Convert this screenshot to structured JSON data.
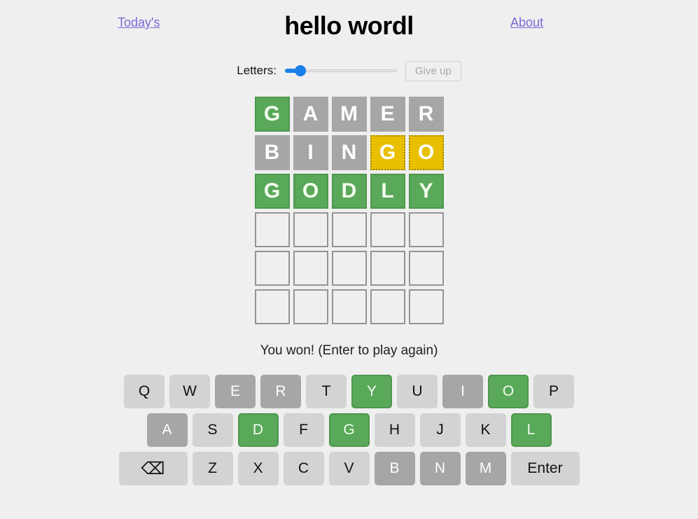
{
  "header": {
    "title": "hello wordl",
    "left_link": "Today's",
    "right_link": "About"
  },
  "controls": {
    "letters_label": "Letters:",
    "slider_value": 5,
    "slider_min": 4,
    "slider_max": 11,
    "give_up_label": "Give up",
    "give_up_disabled": true
  },
  "board": {
    "rows": 6,
    "columns": 5,
    "guesses": [
      {
        "word": "GAMER",
        "tiles": [
          {
            "letter": "G",
            "state": "correct"
          },
          {
            "letter": "A",
            "state": "absent"
          },
          {
            "letter": "M",
            "state": "absent"
          },
          {
            "letter": "E",
            "state": "absent"
          },
          {
            "letter": "R",
            "state": "absent"
          }
        ]
      },
      {
        "word": "BINGO",
        "tiles": [
          {
            "letter": "B",
            "state": "absent"
          },
          {
            "letter": "I",
            "state": "absent"
          },
          {
            "letter": "N",
            "state": "absent"
          },
          {
            "letter": "G",
            "state": "elsewhere"
          },
          {
            "letter": "O",
            "state": "elsewhere"
          }
        ]
      },
      {
        "word": "GODLY",
        "tiles": [
          {
            "letter": "G",
            "state": "correct"
          },
          {
            "letter": "O",
            "state": "correct"
          },
          {
            "letter": "D",
            "state": "correct"
          },
          {
            "letter": "L",
            "state": "correct"
          },
          {
            "letter": "Y",
            "state": "correct"
          }
        ]
      },
      {
        "word": "",
        "tiles": [
          {
            "letter": "",
            "state": "empty"
          },
          {
            "letter": "",
            "state": "empty"
          },
          {
            "letter": "",
            "state": "empty"
          },
          {
            "letter": "",
            "state": "empty"
          },
          {
            "letter": "",
            "state": "empty"
          }
        ]
      },
      {
        "word": "",
        "tiles": [
          {
            "letter": "",
            "state": "empty"
          },
          {
            "letter": "",
            "state": "empty"
          },
          {
            "letter": "",
            "state": "empty"
          },
          {
            "letter": "",
            "state": "empty"
          },
          {
            "letter": "",
            "state": "empty"
          }
        ]
      },
      {
        "word": "",
        "tiles": [
          {
            "letter": "",
            "state": "empty"
          },
          {
            "letter": "",
            "state": "empty"
          },
          {
            "letter": "",
            "state": "empty"
          },
          {
            "letter": "",
            "state": "empty"
          },
          {
            "letter": "",
            "state": "empty"
          }
        ]
      }
    ]
  },
  "status": {
    "message": "You won! (Enter to play again)"
  },
  "keyboard": {
    "rows": [
      [
        {
          "label": "Q",
          "name": "key-q",
          "state": "default"
        },
        {
          "label": "W",
          "name": "key-w",
          "state": "default"
        },
        {
          "label": "E",
          "name": "key-e",
          "state": "absent"
        },
        {
          "label": "R",
          "name": "key-r",
          "state": "absent"
        },
        {
          "label": "T",
          "name": "key-t",
          "state": "default"
        },
        {
          "label": "Y",
          "name": "key-y",
          "state": "correct"
        },
        {
          "label": "U",
          "name": "key-u",
          "state": "default"
        },
        {
          "label": "I",
          "name": "key-i",
          "state": "absent"
        },
        {
          "label": "O",
          "name": "key-o",
          "state": "correct"
        },
        {
          "label": "P",
          "name": "key-p",
          "state": "default"
        }
      ],
      [
        {
          "label": "A",
          "name": "key-a",
          "state": "absent"
        },
        {
          "label": "S",
          "name": "key-s",
          "state": "default"
        },
        {
          "label": "D",
          "name": "key-d",
          "state": "correct"
        },
        {
          "label": "F",
          "name": "key-f",
          "state": "default"
        },
        {
          "label": "G",
          "name": "key-g",
          "state": "correct"
        },
        {
          "label": "H",
          "name": "key-h",
          "state": "default"
        },
        {
          "label": "J",
          "name": "key-j",
          "state": "default"
        },
        {
          "label": "K",
          "name": "key-k",
          "state": "default"
        },
        {
          "label": "L",
          "name": "key-l",
          "state": "correct"
        }
      ],
      [
        {
          "label": "⌫",
          "name": "key-backspace",
          "state": "default",
          "wide": true,
          "icon": "backspace-icon"
        },
        {
          "label": "Z",
          "name": "key-z",
          "state": "default"
        },
        {
          "label": "X",
          "name": "key-x",
          "state": "default"
        },
        {
          "label": "C",
          "name": "key-c",
          "state": "default"
        },
        {
          "label": "V",
          "name": "key-v",
          "state": "default"
        },
        {
          "label": "B",
          "name": "key-b",
          "state": "absent"
        },
        {
          "label": "N",
          "name": "key-n",
          "state": "absent"
        },
        {
          "label": "M",
          "name": "key-m",
          "state": "absent"
        },
        {
          "label": "Enter",
          "name": "key-enter",
          "state": "default",
          "wide": true
        }
      ]
    ]
  },
  "colors": {
    "background": "#efefef",
    "correct": "#5aa85a",
    "elsewhere": "#e8c000",
    "absent": "#a6a6a6",
    "key_default": "#d3d3d3",
    "link": "#7a6ad8",
    "slider_accent": "#1a7fe8"
  }
}
